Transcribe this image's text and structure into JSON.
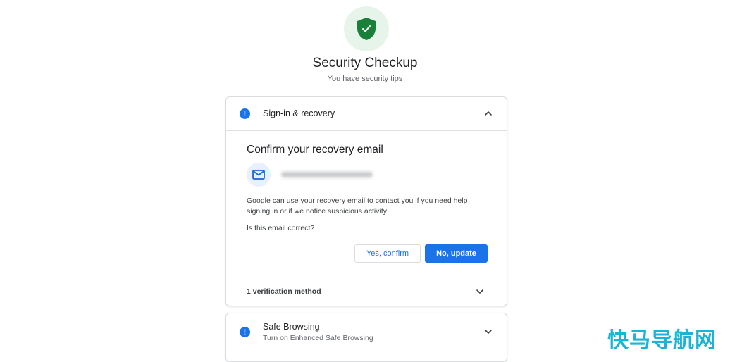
{
  "header": {
    "icon": "shield-check-icon",
    "title": "Security Checkup",
    "subtitle": "You have security tips"
  },
  "signin_card": {
    "alert_icon": "!",
    "label": "Sign-in & recovery",
    "expanded": true,
    "confirm_title": "Confirm your recovery email",
    "email_icon": "mail-icon",
    "description": "Google can use your recovery email to contact you if you need help signing in or if we notice suspicious activity",
    "question": "Is this email correct?",
    "confirm_button": "Yes, confirm",
    "update_button": "No, update",
    "footer_label": "1 verification method"
  },
  "safe_browsing_card": {
    "alert_icon": "!",
    "title": "Safe Browsing",
    "subtitle": "Turn on Enhanced Safe Browsing"
  },
  "watermark": "快马导航网",
  "colors": {
    "accent": "#1a73e8",
    "shield": "#188038",
    "shield_bg": "#e6f4ea",
    "watermark": "#19b4d6"
  }
}
